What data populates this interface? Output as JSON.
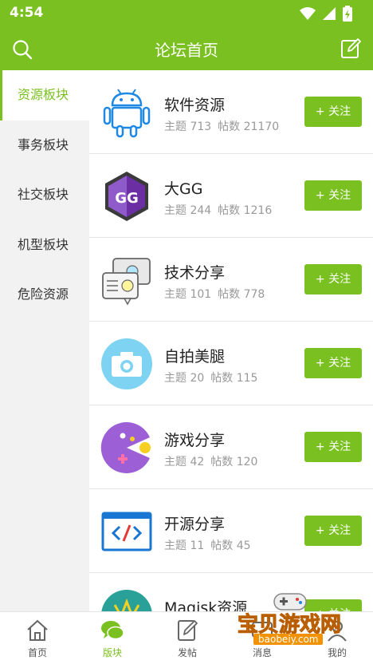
{
  "status_bar": {
    "time": "4:54",
    "icons": [
      "wifi-icon",
      "signal-icon",
      "battery-icon"
    ]
  },
  "header": {
    "title": "论坛首页",
    "left_icon": "search-icon",
    "right_icon": "edit-icon"
  },
  "sidebar": {
    "items": [
      {
        "label": "资源板块",
        "active": true
      },
      {
        "label": "事务板块",
        "active": false
      },
      {
        "label": "社交板块",
        "active": false
      },
      {
        "label": "机型板块",
        "active": false
      },
      {
        "label": "危险资源",
        "active": false
      }
    ]
  },
  "forums": [
    {
      "name": "软件资源",
      "topics": "主题 713",
      "posts": "帖数 21170",
      "follow": "+ 关注",
      "icon": "android-icon"
    },
    {
      "name": "大GG",
      "topics": "主题 244",
      "posts": "帖数 1216",
      "follow": "+ 关注",
      "icon": "gg-icon"
    },
    {
      "name": "技术分享",
      "topics": "主题 101",
      "posts": "帖数 778",
      "follow": "+ 关注",
      "icon": "chat-bubbles-icon"
    },
    {
      "name": "自拍美腿",
      "topics": "主题 20",
      "posts": "帖数 115",
      "follow": "+ 关注",
      "icon": "camera-icon"
    },
    {
      "name": "游戏分享",
      "topics": "主题 42",
      "posts": "帖数 120",
      "follow": "+ 关注",
      "icon": "pacman-icon"
    },
    {
      "name": "开源分享",
      "topics": "主题 11",
      "posts": "帖数 45",
      "follow": "+ 关注",
      "icon": "code-window-icon"
    },
    {
      "name": "Magisk资源",
      "topics": "",
      "posts": "",
      "follow": "+ 关注",
      "icon": "magisk-icon"
    }
  ],
  "tabbar": {
    "items": [
      {
        "label": "首页",
        "icon": "home-icon",
        "active": false
      },
      {
        "label": "版块",
        "icon": "chat-icon",
        "active": true
      },
      {
        "label": "发帖",
        "icon": "compose-icon",
        "active": false
      },
      {
        "label": "消息",
        "icon": "message-icon",
        "active": false
      },
      {
        "label": "我的",
        "icon": "user-icon",
        "active": false
      }
    ]
  },
  "watermark": {
    "text": "宝贝游戏网",
    "url": "baobeiy.com"
  },
  "colors": {
    "accent": "#7ac020",
    "sidebar_bg": "#f2f2f2",
    "meta_text": "#999999"
  }
}
